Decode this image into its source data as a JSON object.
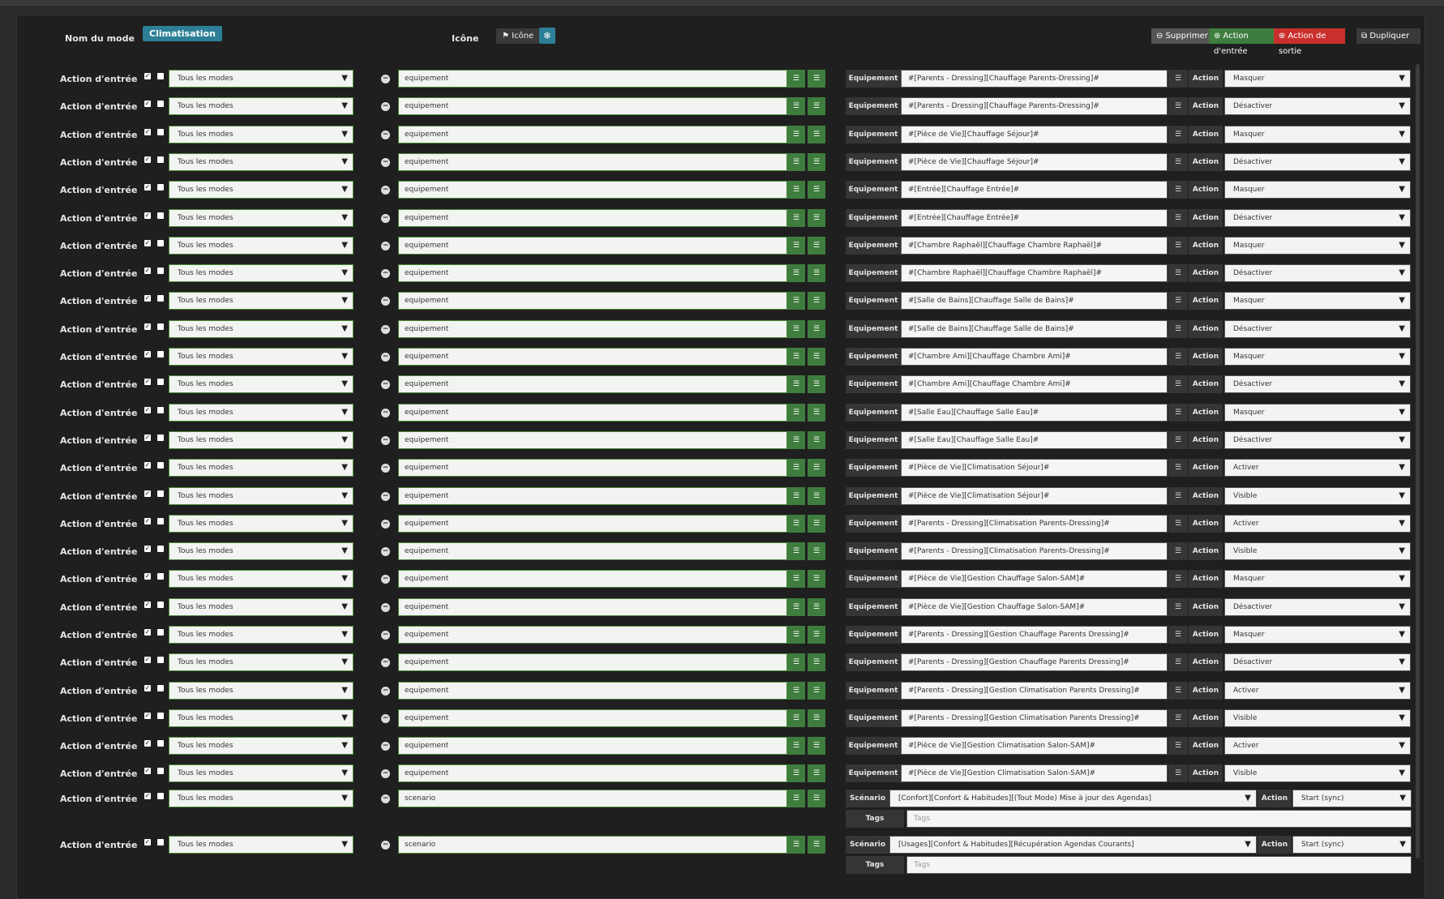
{
  "header": {
    "mode_name_label": "Nom du mode",
    "mode_name_value": "Climatisation",
    "icon_label": "Icône",
    "icon_button": "⚑ Icône",
    "icon_preview": "❄",
    "buttons": {
      "delete": "⊖ Supprimer",
      "entry_action": "⊕ Action d'entrée",
      "exit_action": "⊕ Action de sortie",
      "duplicate": "⧉ Dupliquer"
    }
  },
  "actions": [
    {
      "label": "Action d'entrée",
      "modes": "Tous les modes",
      "cmd": "equipement",
      "type_label": "Equipement",
      "target": "#[Parents - Dressing][Chauffage Parents-Dressing]#",
      "action_label": "Action",
      "action": "Masquer"
    },
    {
      "label": "Action d'entrée",
      "modes": "Tous les modes",
      "cmd": "equipement",
      "type_label": "Equipement",
      "target": "#[Parents - Dressing][Chauffage Parents-Dressing]#",
      "action_label": "Action",
      "action": "Désactiver"
    },
    {
      "label": "Action d'entrée",
      "modes": "Tous les modes",
      "cmd": "equipement",
      "type_label": "Equipement",
      "target": "#[Pièce de Vie][Chauffage Séjour]#",
      "action_label": "Action",
      "action": "Masquer"
    },
    {
      "label": "Action d'entrée",
      "modes": "Tous les modes",
      "cmd": "equipement",
      "type_label": "Equipement",
      "target": "#[Pièce de Vie][Chauffage Séjour]#",
      "action_label": "Action",
      "action": "Désactiver"
    },
    {
      "label": "Action d'entrée",
      "modes": "Tous les modes",
      "cmd": "equipement",
      "type_label": "Equipement",
      "target": "#[Entrée][Chauffage Entrée]#",
      "action_label": "Action",
      "action": "Masquer"
    },
    {
      "label": "Action d'entrée",
      "modes": "Tous les modes",
      "cmd": "equipement",
      "type_label": "Equipement",
      "target": "#[Entrée][Chauffage Entrée]#",
      "action_label": "Action",
      "action": "Désactiver"
    },
    {
      "label": "Action d'entrée",
      "modes": "Tous les modes",
      "cmd": "equipement",
      "type_label": "Equipement",
      "target": "#[Chambre Raphaël][Chauffage Chambre Raphaël]#",
      "action_label": "Action",
      "action": "Masquer"
    },
    {
      "label": "Action d'entrée",
      "modes": "Tous les modes",
      "cmd": "equipement",
      "type_label": "Equipement",
      "target": "#[Chambre Raphaël][Chauffage Chambre Raphaël]#",
      "action_label": "Action",
      "action": "Désactiver"
    },
    {
      "label": "Action d'entrée",
      "modes": "Tous les modes",
      "cmd": "equipement",
      "type_label": "Equipement",
      "target": "#[Salle de Bains][Chauffage Salle de Bains]#",
      "action_label": "Action",
      "action": "Masquer"
    },
    {
      "label": "Action d'entrée",
      "modes": "Tous les modes",
      "cmd": "equipement",
      "type_label": "Equipement",
      "target": "#[Salle de Bains][Chauffage Salle de Bains]#",
      "action_label": "Action",
      "action": "Désactiver"
    },
    {
      "label": "Action d'entrée",
      "modes": "Tous les modes",
      "cmd": "equipement",
      "type_label": "Equipement",
      "target": "#[Chambre Ami][Chauffage Chambre Ami]#",
      "action_label": "Action",
      "action": "Masquer"
    },
    {
      "label": "Action d'entrée",
      "modes": "Tous les modes",
      "cmd": "equipement",
      "type_label": "Equipement",
      "target": "#[Chambre Ami][Chauffage Chambre Ami]#",
      "action_label": "Action",
      "action": "Désactiver"
    },
    {
      "label": "Action d'entrée",
      "modes": "Tous les modes",
      "cmd": "equipement",
      "type_label": "Equipement",
      "target": "#[Salle Eau][Chauffage Salle Eau]#",
      "action_label": "Action",
      "action": "Masquer"
    },
    {
      "label": "Action d'entrée",
      "modes": "Tous les modes",
      "cmd": "equipement",
      "type_label": "Equipement",
      "target": "#[Salle Eau][Chauffage Salle Eau]#",
      "action_label": "Action",
      "action": "Désactiver"
    },
    {
      "label": "Action d'entrée",
      "modes": "Tous les modes",
      "cmd": "equipement",
      "type_label": "Equipement",
      "target": "#[Pièce de Vie][Climatisation Séjour]#",
      "action_label": "Action",
      "action": "Activer"
    },
    {
      "label": "Action d'entrée",
      "modes": "Tous les modes",
      "cmd": "equipement",
      "type_label": "Equipement",
      "target": "#[Pièce de Vie][Climatisation Séjour]#",
      "action_label": "Action",
      "action": "Visible"
    },
    {
      "label": "Action d'entrée",
      "modes": "Tous les modes",
      "cmd": "equipement",
      "type_label": "Equipement",
      "target": "#[Parents - Dressing][Climatisation Parents-Dressing]#",
      "action_label": "Action",
      "action": "Activer"
    },
    {
      "label": "Action d'entrée",
      "modes": "Tous les modes",
      "cmd": "equipement",
      "type_label": "Equipement",
      "target": "#[Parents - Dressing][Climatisation Parents-Dressing]#",
      "action_label": "Action",
      "action": "Visible"
    },
    {
      "label": "Action d'entrée",
      "modes": "Tous les modes",
      "cmd": "equipement",
      "type_label": "Equipement",
      "target": "#[Pièce de Vie][Gestion Chauffage Salon-SAM]#",
      "action_label": "Action",
      "action": "Masquer"
    },
    {
      "label": "Action d'entrée",
      "modes": "Tous les modes",
      "cmd": "equipement",
      "type_label": "Equipement",
      "target": "#[Pièce de Vie][Gestion Chauffage Salon-SAM]#",
      "action_label": "Action",
      "action": "Désactiver"
    },
    {
      "label": "Action d'entrée",
      "modes": "Tous les modes",
      "cmd": "equipement",
      "type_label": "Equipement",
      "target": "#[Parents - Dressing][Gestion Chauffage Parents Dressing]#",
      "action_label": "Action",
      "action": "Masquer"
    },
    {
      "label": "Action d'entrée",
      "modes": "Tous les modes",
      "cmd": "equipement",
      "type_label": "Equipement",
      "target": "#[Parents - Dressing][Gestion Chauffage Parents Dressing]#",
      "action_label": "Action",
      "action": "Désactiver"
    },
    {
      "label": "Action d'entrée",
      "modes": "Tous les modes",
      "cmd": "equipement",
      "type_label": "Equipement",
      "target": "#[Parents - Dressing][Gestion Climatisation Parents Dressing]#",
      "action_label": "Action",
      "action": "Activer"
    },
    {
      "label": "Action d'entrée",
      "modes": "Tous les modes",
      "cmd": "equipement",
      "type_label": "Equipement",
      "target": "#[Parents - Dressing][Gestion Climatisation Parents Dressing]#",
      "action_label": "Action",
      "action": "Visible"
    },
    {
      "label": "Action d'entrée",
      "modes": "Tous les modes",
      "cmd": "equipement",
      "type_label": "Equipement",
      "target": "#[Pièce de Vie][Gestion Climatisation Salon-SAM]#",
      "action_label": "Action",
      "action": "Activer"
    },
    {
      "label": "Action d'entrée",
      "modes": "Tous les modes",
      "cmd": "equipement",
      "type_label": "Equipement",
      "target": "#[Pièce de Vie][Gestion Climatisation Salon-SAM]#",
      "action_label": "Action",
      "action": "Visible"
    }
  ],
  "scenarios": [
    {
      "label": "Action d'entrée",
      "modes": "Tous les modes",
      "cmd": "scenario",
      "type_label": "Scénario",
      "target": "[Confort][Confort & Habitudes][(Tout Mode) Mise à jour des Agendas]",
      "action_label": "Action",
      "action": "Start (sync)",
      "tags_label": "Tags",
      "tags_placeholder": "Tags"
    },
    {
      "label": "Action d'entrée",
      "modes": "Tous les modes",
      "cmd": "scenario",
      "type_label": "Scénario",
      "target": "[Usages][Confort & Habitudes][Récupération Agendas Courants]",
      "action_label": "Action",
      "action": "Start (sync)",
      "tags_label": "Tags",
      "tags_placeholder": "Tags"
    }
  ]
}
